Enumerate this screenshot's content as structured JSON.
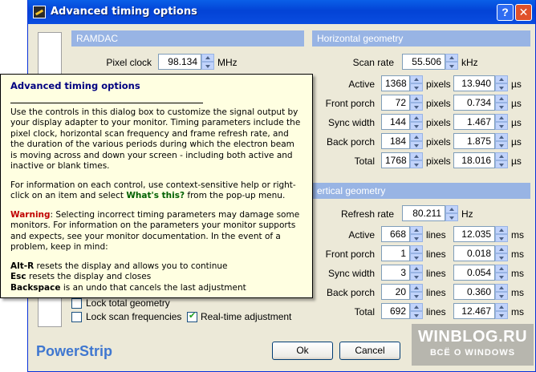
{
  "window": {
    "title": "Advanced timing options",
    "help_btn": "?",
    "close_btn": "✕"
  },
  "ramdac": {
    "header": "RAMDAC",
    "pixel_clock_label": "Pixel clock",
    "pixel_clock_value": "98.134",
    "pixel_clock_unit": "MHz"
  },
  "horizontal": {
    "header": "Horizontal geometry",
    "scan_rate_label": "Scan rate",
    "scan_rate_value": "55.506",
    "scan_rate_unit": "kHz",
    "rows": [
      {
        "label": "Active",
        "value": "1368",
        "unit": "pixels",
        "time": "13.940",
        "time_unit": "µs"
      },
      {
        "label": "Front porch",
        "value": "72",
        "unit": "pixels",
        "time": "0.734",
        "time_unit": "µs"
      },
      {
        "label": "Sync width",
        "value": "144",
        "unit": "pixels",
        "time": "1.467",
        "time_unit": "µs"
      },
      {
        "label": "Back porch",
        "value": "184",
        "unit": "pixels",
        "time": "1.875",
        "time_unit": "µs"
      },
      {
        "label": "Total",
        "value": "1768",
        "unit": "pixels",
        "time": "18.016",
        "time_unit": "µs"
      }
    ]
  },
  "vertical": {
    "header": "ertical geometry",
    "refresh_label": "Refresh rate",
    "refresh_value": "80.211",
    "refresh_unit": "Hz",
    "rows": [
      {
        "label": "Active",
        "value": "668",
        "unit": "lines",
        "time": "12.035",
        "time_unit": "ms"
      },
      {
        "label": "Front porch",
        "value": "1",
        "unit": "lines",
        "time": "0.018",
        "time_unit": "ms"
      },
      {
        "label": "Sync width",
        "value": "3",
        "unit": "lines",
        "time": "0.054",
        "time_unit": "ms"
      },
      {
        "label": "Back porch",
        "value": "20",
        "unit": "lines",
        "time": "0.360",
        "time_unit": "ms"
      },
      {
        "label": "Total",
        "value": "692",
        "unit": "lines",
        "time": "12.467",
        "time_unit": "ms"
      }
    ]
  },
  "options": {
    "lock_total": "Lock total geometry",
    "lock_scan": "Lock scan frequencies",
    "realtime": "Real-time adjustment"
  },
  "tooltip": {
    "title": "Advanced timing options",
    "p1": "Use the controls in this dialog box to customize the signal output by your display adapter to your monitor. Timing parameters include the pixel clock, horizontal scan frequency and frame refresh rate, and the duration of the various periods during which the electron beam is moving across and down your screen - including both active and inactive or blank times.",
    "p2_a": "For information on each control, use context-sensitive help or right-click on an item and select ",
    "p2_link": "What's this?",
    "p2_b": " from the pop-up menu.",
    "warning_word": "Warning",
    "p3": ": Selecting incorrect timing parameters may damage some monitors. For information on the parameters your monitor supports and expects, see your monitor documentation. In the event of a problem, keep in mind:",
    "k1": "Alt-R",
    "k1_text": " resets the display and allows you to continue",
    "k2": "Esc",
    "k2_text": " resets the display and closes",
    "k3": "Backspace",
    "k3_text": " is an undo that cancels the last adjustment"
  },
  "footer": {
    "brand": "PowerStrip",
    "ok": "Ok",
    "cancel": "Cancel"
  },
  "watermark": {
    "line1": "WINBLOG.RU",
    "line2": "ВСЁ О WINDOWS"
  }
}
